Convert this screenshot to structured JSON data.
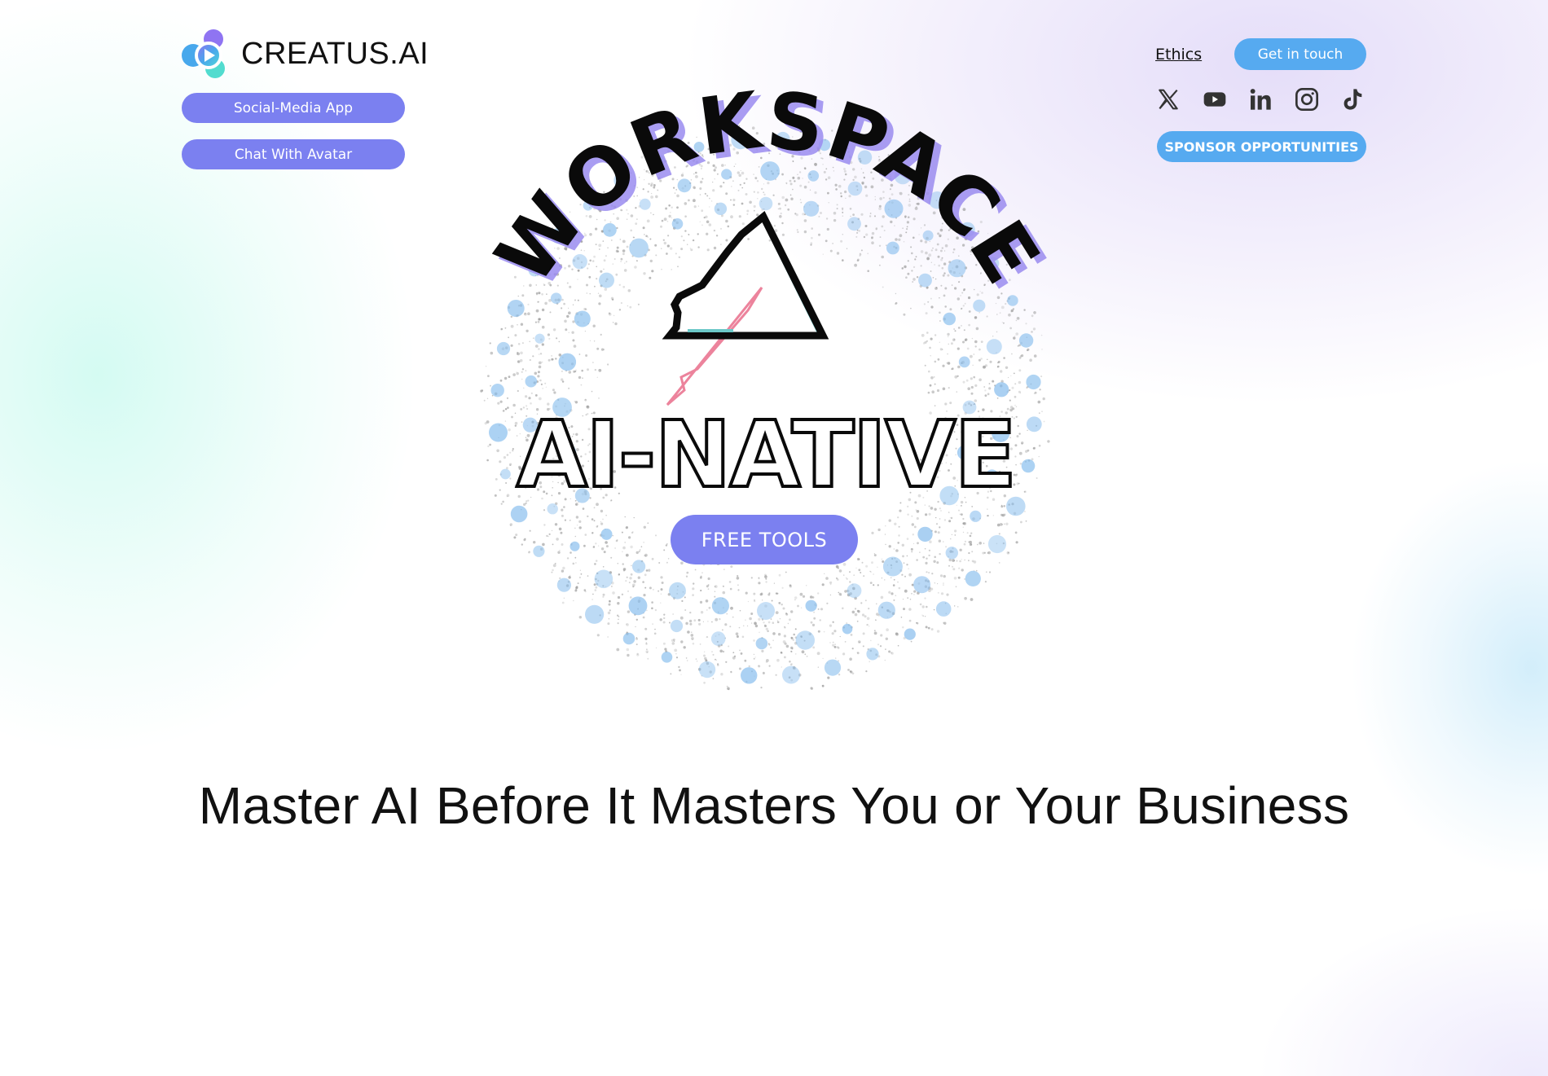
{
  "brand": {
    "name": "CREATUS.AI",
    "logo_icon": "creatus-play-blob-icon"
  },
  "nav_left": {
    "social_media_app": "Social-Media App",
    "chat_with_avatar": "Chat With Avatar"
  },
  "nav_right": {
    "ethics": "Ethics",
    "get_in_touch": "Get in touch",
    "sponsor": "SPONSOR OPPORTUNITIES",
    "social_links": [
      {
        "name": "X",
        "icon": "x-twitter-icon"
      },
      {
        "name": "YouTube",
        "icon": "youtube-icon"
      },
      {
        "name": "LinkedIn",
        "icon": "linkedin-icon"
      },
      {
        "name": "Instagram",
        "icon": "instagram-icon"
      },
      {
        "name": "TikTok",
        "icon": "tiktok-icon"
      }
    ]
  },
  "hero": {
    "badge_arc_text": "WORKSPACE",
    "badge_main_text": "AI-NATIVE",
    "badge_icon": "glitch-triangle-icon",
    "cta": "FREE TOOLS"
  },
  "headline": "Master AI Before It Masters You or Your Business",
  "colors": {
    "violet_button": "#7b80f0",
    "blue_button": "#56aaf0",
    "text": "#111111",
    "arc_shadow": "#9b8cf0",
    "spray_dot": "#8cc0ee"
  }
}
